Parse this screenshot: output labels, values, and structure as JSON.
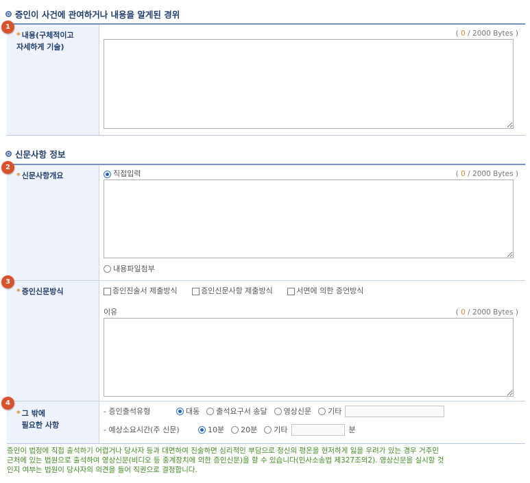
{
  "section1": {
    "title": "증인이 사건에 관여하거나 내용을 알게된 경위"
  },
  "row1": {
    "badge": "1",
    "label_line1": "내용(구체적이고",
    "label_line2": "자세하게 기술)",
    "count": "0",
    "bytes_suffix": "/ 2000 Bytes )",
    "bytes_prefix": "(",
    "value": ""
  },
  "section2": {
    "title": "신문사항 정보"
  },
  "row2": {
    "badge": "2",
    "label": "신문사항개요",
    "direct_input": "직접입력",
    "count": "0",
    "bytes_prefix": "(",
    "bytes_suffix": "/ 2000 Bytes )",
    "value": "",
    "file_attach": "내용파일첨부"
  },
  "row3": {
    "badge": "3",
    "label": "증인신문방식",
    "options": [
      "증인진술서 제출방식",
      "증인신문사항 제출방식",
      "서면에 의한 증언방식"
    ],
    "reason_label": "이유",
    "count": "0",
    "bytes_prefix": "(",
    "bytes_suffix": "/ 2000 Bytes )",
    "value": ""
  },
  "row4": {
    "badge": "4",
    "label_line1": "그 밖에",
    "label_line2": "필요한 사항",
    "attendance_label": "- 증인출석유형",
    "attendance_options": [
      "대동",
      "출석요구서 송달",
      "영상신문",
      "기타"
    ],
    "attendance_selected": "대동",
    "time_label": "- 예상소요시간(주 신문)",
    "time_options": [
      "10분",
      "20분",
      "기타"
    ],
    "time_selected": "10분",
    "minutes_unit": "분"
  },
  "notice": {
    "line1": "증인이 법정에 직접 출석하기 어렵거나 당사자 등과 대면하여 진술하면 심리적인 부담으로 정신의 평온을 현저하게 잃을 우려가 있는 경우 거주민",
    "line2": "근처에 있는 법원으로 출석하여 영상신문(비디오 등 중계장치에 의한 증인신문)을 할 수 있습니다(민사소송법 제327조의2). 영상신문을 실시할 것",
    "line3": "인지 여부는 법원이 당사자의 의견을 들어 직권으로 결정합니다."
  },
  "colors": {
    "accent": "#1f3e6e",
    "badge": "#d9522a",
    "notice": "#3e8e1e",
    "counter": "#e28a1e"
  }
}
